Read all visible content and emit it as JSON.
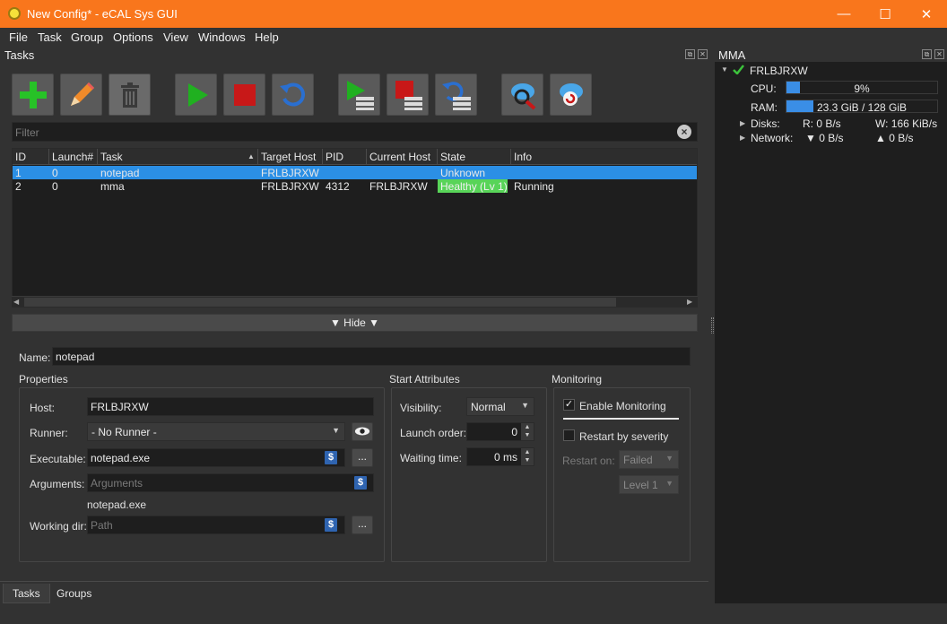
{
  "window": {
    "title": "New Config* - eCAL Sys GUI",
    "minimize": "—",
    "maximize": "☐",
    "close": "✕"
  },
  "menu": [
    "File",
    "Task",
    "Group",
    "Options",
    "View",
    "Windows",
    "Help"
  ],
  "tasks_dock": {
    "title": "Tasks",
    "filter_placeholder": "Filter",
    "columns": [
      "ID",
      "Launch#",
      "Task",
      "Target Host",
      "PID",
      "Current Host",
      "State",
      "Info"
    ],
    "rows": [
      {
        "id": "1",
        "launch": "0",
        "task": "notepad",
        "target_host": "FRLBJRXW",
        "pid": "",
        "current_host": "",
        "state": "Unknown",
        "info": ""
      },
      {
        "id": "2",
        "launch": "0",
        "task": "mma",
        "target_host": "FRLBJRXW",
        "pid": "4312",
        "current_host": "FRLBJRXW",
        "state": "Healthy (Lv 1)",
        "info": "Running"
      }
    ],
    "hide_label": "▼ Hide ▼"
  },
  "editor": {
    "name_label": "Name:",
    "name_value": "notepad",
    "properties": {
      "title": "Properties",
      "host_label": "Host:",
      "host_value": "FRLBJRXW",
      "runner_label": "Runner:",
      "runner_value": "- No Runner -",
      "executable_label": "Executable:",
      "executable_value": "notepad.exe",
      "arguments_label": "Arguments:",
      "arguments_placeholder": "Arguments",
      "command_preview": "notepad.exe",
      "working_dir_label": "Working dir:",
      "working_dir_placeholder": "Path",
      "browse_label": "...",
      "dollar_label": "$"
    },
    "start_attributes": {
      "title": "Start Attributes",
      "visibility_label": "Visibility:",
      "visibility_value": "Normal",
      "launch_order_label": "Launch order:",
      "launch_order_value": "0",
      "waiting_time_label": "Waiting time:",
      "waiting_time_value": "0 ms"
    },
    "monitoring": {
      "title": "Monitoring",
      "enable_label": "Enable Monitoring",
      "enable_checked": true,
      "restart_label": "Restart by severity",
      "restart_checked": false,
      "restart_on_label": "Restart on:",
      "restart_on_value": "Failed",
      "level_value": "Level 1"
    }
  },
  "bottom_tabs": [
    "Tasks",
    "Groups"
  ],
  "mma": {
    "title": "MMA",
    "host": "FRLBJRXW",
    "cpu_label": "CPU:",
    "cpu_value": "9%",
    "cpu_fraction": 0.09,
    "ram_label": "RAM:",
    "ram_value": "23.3 GiB / 128 GiB",
    "ram_fraction": 0.18,
    "disks_label": "Disks:",
    "disks_read": "R: 0 B/s",
    "disks_write": "W: 166 KiB/s",
    "network_label": "Network:",
    "network_down": "▼ 0 B/s",
    "network_up": "▲ 0 B/s"
  },
  "colors": {
    "titlebar": "#f9761c",
    "selection": "#2b8fe5",
    "healthy": "#58d458",
    "window_bg": "#323232"
  }
}
